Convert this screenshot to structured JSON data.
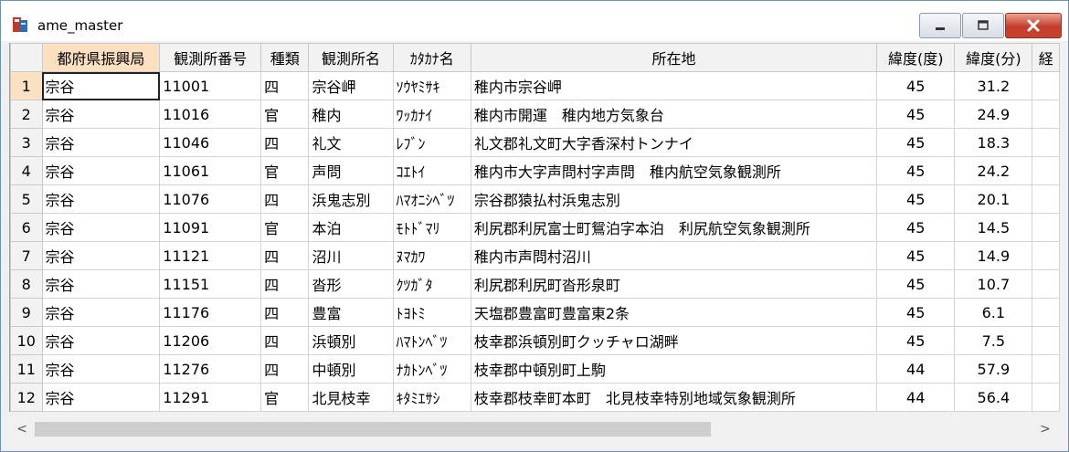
{
  "window": {
    "title": "ame_master"
  },
  "grid": {
    "columns": [
      "都府県振興局",
      "観測所番号",
      "種類",
      "観測所名",
      "ｶﾀｶﾅ名",
      "所在地",
      "緯度(度)",
      "緯度(分)",
      "経"
    ],
    "rows": [
      {
        "no": "1",
        "cells": [
          "宗谷",
          "11001",
          "四",
          "宗谷岬",
          "ｿｳﾔﾐｻｷ",
          "稚内市宗谷岬",
          "45",
          "31.2"
        ]
      },
      {
        "no": "2",
        "cells": [
          "宗谷",
          "11016",
          "官",
          "稚内",
          "ﾜｯｶﾅｲ",
          "稚内市開運　稚内地方気象台",
          "45",
          "24.9"
        ]
      },
      {
        "no": "3",
        "cells": [
          "宗谷",
          "11046",
          "四",
          "礼文",
          "ﾚﾌﾞﾝ",
          "礼文郡礼文町大字香深村トンナイ",
          "45",
          "18.3"
        ]
      },
      {
        "no": "4",
        "cells": [
          "宗谷",
          "11061",
          "官",
          "声問",
          "ｺｴﾄｲ",
          "稚内市大字声問村字声問　稚内航空気象観測所",
          "45",
          "24.2"
        ]
      },
      {
        "no": "5",
        "cells": [
          "宗谷",
          "11076",
          "四",
          "浜鬼志別",
          "ﾊﾏｵﾆｼﾍﾞﾂ",
          "宗谷郡猿払村浜鬼志別",
          "45",
          "20.1"
        ]
      },
      {
        "no": "6",
        "cells": [
          "宗谷",
          "11091",
          "官",
          "本泊",
          "ﾓﾄﾄﾞﾏﾘ",
          "利尻郡利尻富士町鴛泊字本泊　利尻航空気象観測所",
          "45",
          "14.5"
        ]
      },
      {
        "no": "7",
        "cells": [
          "宗谷",
          "11121",
          "四",
          "沼川",
          "ﾇﾏｶﾜ",
          "稚内市声問村沼川",
          "45",
          "14.9"
        ]
      },
      {
        "no": "8",
        "cells": [
          "宗谷",
          "11151",
          "四",
          "沓形",
          "ｸﾂｶﾞﾀ",
          "利尻郡利尻町沓形泉町",
          "45",
          "10.7"
        ]
      },
      {
        "no": "9",
        "cells": [
          "宗谷",
          "11176",
          "四",
          "豊富",
          "ﾄﾖﾄﾐ",
          "天塩郡豊富町豊富東2条",
          "45",
          "6.1"
        ]
      },
      {
        "no": "10",
        "cells": [
          "宗谷",
          "11206",
          "四",
          "浜頓別",
          "ﾊﾏﾄﾝﾍﾞﾂ",
          "枝幸郡浜頓別町クッチャロ湖畔",
          "45",
          "7.5"
        ]
      },
      {
        "no": "11",
        "cells": [
          "宗谷",
          "11276",
          "四",
          "中頓別",
          "ﾅｶﾄﾝﾍﾞﾂ",
          "枝幸郡中頓別町上駒",
          "44",
          "57.9"
        ]
      },
      {
        "no": "12",
        "cells": [
          "宗谷",
          "11291",
          "官",
          "北見枝幸",
          "ｷﾀﾐｴｻｼ",
          "枝幸郡枝幸町本町　北見枝幸特別地域気象観測所",
          "44",
          "56.4"
        ]
      }
    ]
  },
  "scrollbar": {
    "left_arrow": "<",
    "right_arrow": ">"
  },
  "colors": {
    "header_bg": "#f2f2f2",
    "active_header_bg": "#fbe1c2",
    "close_button": "#c53b2a"
  }
}
